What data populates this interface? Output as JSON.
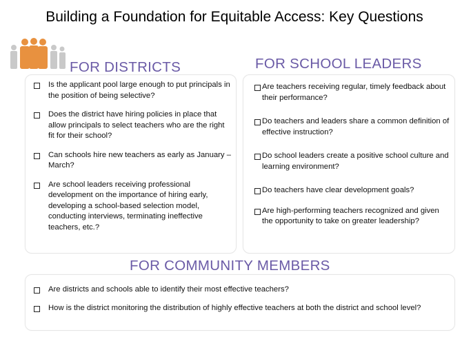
{
  "title": "Building a Foundation for Equitable Access: Key Questions",
  "colors": {
    "heading": "#6a5aa6",
    "people_primary": "#e8913f",
    "people_secondary": "#c9c9c9"
  },
  "icons": {
    "people": "people-group-icon",
    "checkbox": "checkbox-icon"
  },
  "districts": {
    "heading": "FOR DISTRICTS",
    "items": [
      "Is the applicant pool large enough to put principals in the position of being selective?",
      "Does the district have hiring policies in place that allow principals to select teachers who are the right fit for their school?",
      "Can schools hire new teachers as early as January – March?",
      "Are school leaders receiving professional development on the importance of hiring early, developing a school-based selection model, conducting interviews, terminating ineffective teachers, etc.?"
    ]
  },
  "school_leaders": {
    "heading": "FOR SCHOOL LEADERS",
    "items": [
      "Are teachers receiving regular, timely feedback about their performance?",
      "Do teachers and leaders share a common definition of effective instruction?",
      "Do school leaders create a positive school culture and learning environment?",
      "Do teachers have clear development goals?",
      "Are high-performing teachers recognized and given the opportunity to take on greater leadership?"
    ]
  },
  "community": {
    "heading": "FOR COMMUNITY MEMBERS",
    "items": [
      "Are districts and schools able to identify their most effective teachers?",
      "How is the district monitoring the distribution of highly effective teachers at both the district and school level?"
    ]
  }
}
